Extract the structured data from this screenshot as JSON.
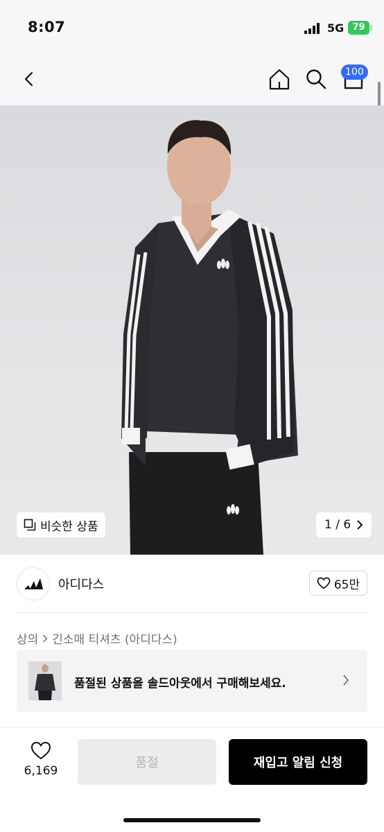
{
  "status_bar": {
    "time": "8:07",
    "network": "5G",
    "battery": "79"
  },
  "nav": {
    "cart_badge": "100"
  },
  "gallery": {
    "similar_label": "비슷한 상품",
    "page_indicator": "1 / 6"
  },
  "brand": {
    "name": "아디다스",
    "likes": "65만"
  },
  "breadcrumb": {
    "category": "상의",
    "subcategory": "긴소매 티셔츠 (아디다스)"
  },
  "soldout_banner": {
    "text": "품절된 상품을 솔드아웃에서 구매해보세요."
  },
  "bottom_bar": {
    "wish_count": "6,169",
    "soldout_label": "품절",
    "restock_label": "재입고 알림 신청"
  }
}
